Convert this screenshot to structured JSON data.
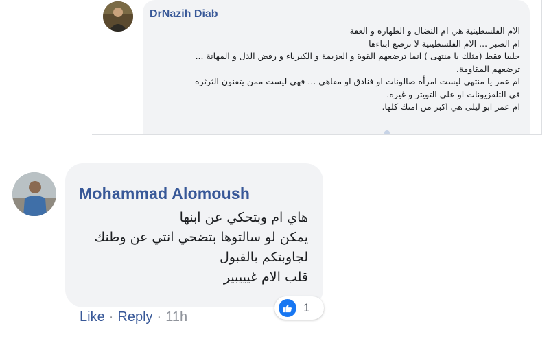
{
  "top_comment": {
    "author": "DrNazih Diab",
    "lines": [
      "الام الفلسطينية هي ام النضال و الطهارة و العفة",
      "ام الصبر ... الام الفلسطينية لا ترضع ابناءها",
      "حليبا فقط (مثلك يا منتهى ) انما ترضعهم القوة و العزيمة و الكبرياء و رفض الذل و المهانة ...",
      "ترضعهم المقاومة.",
      "ام عمر يا منتهى ليست امرأة صالونات او فنادق او مقاهي ... فهي ليست ممن يتقنون الثرثرة",
      "في التلفزيونات او على التويتر و غيره.",
      "ام عمر ابو ليلى هي اكبر من امتك كلها."
    ]
  },
  "bottom_comment": {
    "author": "Mohammad Alomoush",
    "lines": [
      "هاي ام وبتحكي عن ابنها",
      "يمكن لو سالتوها بتضحي انتي عن وطنك",
      "لجاوبتكم بالقبول",
      "قلب الام غيييبير"
    ],
    "reaction_icon": "like-icon",
    "reaction_count": "1",
    "actions": {
      "like_label": "Like",
      "reply_label": "Reply",
      "separator": "·",
      "timestamp": "11h"
    }
  },
  "colors": {
    "name": "#385898",
    "bubble": "#f2f3f5",
    "like_blue": "#1877f2",
    "meta_gray": "#90949c"
  }
}
